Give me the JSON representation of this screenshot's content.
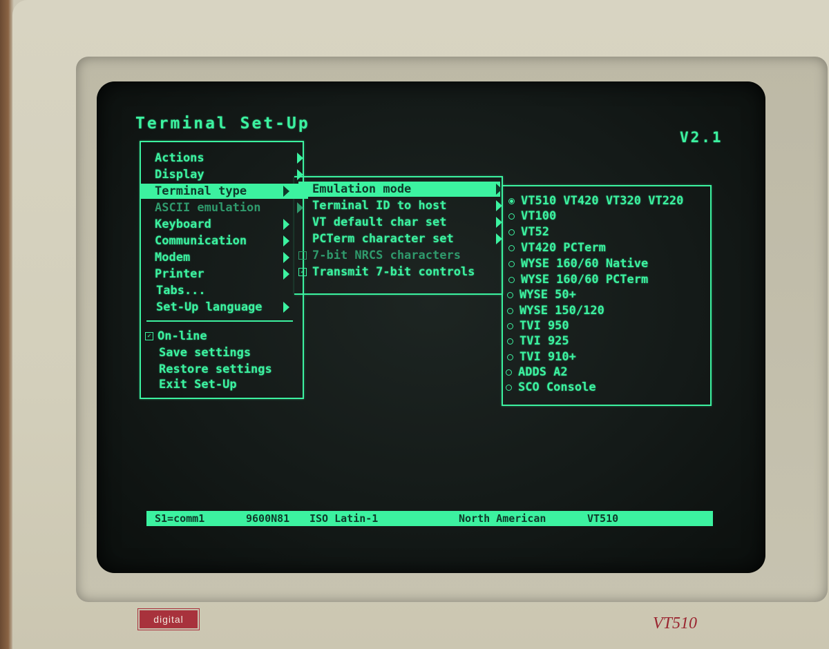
{
  "screen": {
    "title": "Terminal Set-Up",
    "version": "V2.1"
  },
  "main_menu": {
    "items": [
      {
        "label": "Actions",
        "has_submenu": true,
        "enabled": true
      },
      {
        "label": "Display",
        "has_submenu": true,
        "enabled": true
      },
      {
        "label": "Terminal type",
        "has_submenu": true,
        "enabled": true,
        "selected": true
      },
      {
        "label": "ASCII emulation",
        "has_submenu": true,
        "enabled": false
      },
      {
        "label": "Keyboard",
        "has_submenu": true,
        "enabled": true
      },
      {
        "label": "Communication",
        "has_submenu": true,
        "enabled": true
      },
      {
        "label": "Modem",
        "has_submenu": true,
        "enabled": true
      },
      {
        "label": "Printer",
        "has_submenu": true,
        "enabled": true
      },
      {
        "label": "Tabs...",
        "has_submenu": false,
        "enabled": true
      },
      {
        "label": "Set-Up language",
        "has_submenu": true,
        "enabled": true
      }
    ],
    "actions": [
      {
        "label": "On-line",
        "checkbox": true,
        "checked": true
      },
      {
        "label": "Save settings"
      },
      {
        "label": "Restore settings"
      },
      {
        "label": "Exit Set-Up"
      }
    ]
  },
  "terminal_type_menu": {
    "items": [
      {
        "label": "Emulation mode",
        "has_submenu": true,
        "selected": true
      },
      {
        "label": "Terminal ID to host",
        "has_submenu": true
      },
      {
        "label": "VT default char set",
        "has_submenu": true
      },
      {
        "label": "PCTerm character set",
        "has_submenu": true
      },
      {
        "label": "7-bit NRCS characters",
        "checkbox": true,
        "checked": false,
        "enabled": false
      },
      {
        "label": "Transmit 7-bit controls",
        "checkbox": true,
        "checked": true
      }
    ]
  },
  "emulation_menu": {
    "options": [
      {
        "label": "VT510 VT420 VT320 VT220",
        "selected": true
      },
      {
        "label": "VT100",
        "selected": false
      },
      {
        "label": "VT52",
        "selected": false
      },
      {
        "label": "VT420 PCTerm",
        "selected": false
      },
      {
        "label": "WYSE 160/60 Native",
        "selected": false
      },
      {
        "label": "WYSE 160/60 PCTerm",
        "selected": false
      },
      {
        "label": "WYSE 50+",
        "selected": false
      },
      {
        "label": "WYSE 150/120",
        "selected": false
      },
      {
        "label": "TVI 950",
        "selected": false
      },
      {
        "label": "TVI 925",
        "selected": false
      },
      {
        "label": "TVI 910+",
        "selected": false
      },
      {
        "label": "ADDS A2",
        "selected": false
      },
      {
        "label": "SCO Console",
        "selected": false
      }
    ]
  },
  "status_bar": {
    "session": "S1=comm1",
    "line": "9600N81",
    "charset": "ISO Latin-1",
    "keyboard": "North American",
    "model": "VT510"
  },
  "hardware": {
    "brand": "digital",
    "model": "VT510"
  },
  "colors": {
    "phosphor": "#3cf2a0",
    "screen_bg": "#141a18",
    "bezel": "#d3cfbb",
    "brand_red": "#a8323c"
  }
}
